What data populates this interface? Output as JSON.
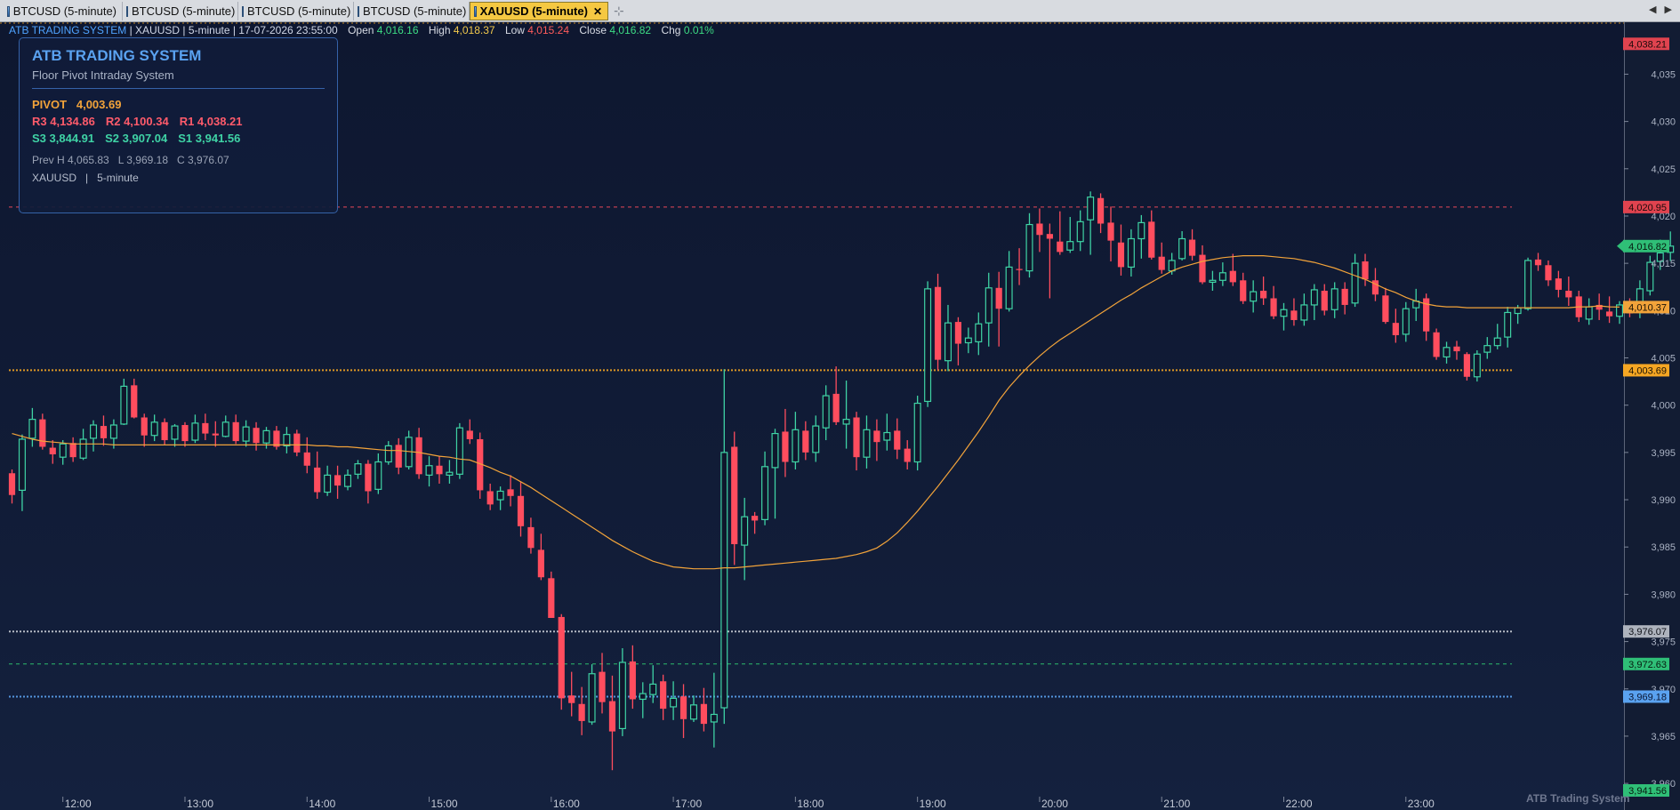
{
  "tabs": [
    {
      "label": "BTCUSD (5-minute)",
      "active": false
    },
    {
      "label": "BTCUSD (5-minute)",
      "active": false
    },
    {
      "label": "BTCUSD (5-minute)",
      "active": false
    },
    {
      "label": "BTCUSD (5-minute)",
      "active": false
    },
    {
      "label": "XAUUSD (5-minute)",
      "active": true
    }
  ],
  "tab_close": "✕",
  "new_tab_icon": "pin-icon",
  "header": {
    "system": "ATB TRADING SYSTEM",
    "rest": " | XAUUSD | 5-minute | 17-07-2026 23:55:00",
    "open_label": "Open",
    "open": "4,016.16",
    "high_label": "High",
    "high": "4,018.37",
    "low_label": "Low",
    "low": "4,015.24",
    "close_label": "Close",
    "close": "4,016.82",
    "chg_label": "Chg",
    "chg": "0.01%"
  },
  "panel": {
    "title": "ATB TRADING SYSTEM",
    "subtitle": "Floor Pivot Intraday System",
    "pivot_label": "PIVOT",
    "pivot": "4,003.69",
    "r3": "R3 4,134.86",
    "r2": "R2 4,100.34",
    "r1": "R1 4,038.21",
    "s3": "S3 3,844.91",
    "s2": "S2 3,907.04",
    "s1": "S1 3,941.56",
    "prev": "Prev H 4,065.83   L 3,969.18   C 3,976.07",
    "symbol": "XAUUSD   |   5-minute"
  },
  "watermark": "ATB Trading System",
  "colors": {
    "up": "#3fd3a5",
    "down": "#ff4d5e",
    "ma": "#f2a33a",
    "pivot": "#f5a623",
    "bg": "#0f172c",
    "r1": "#ff5b6b",
    "prevH": "#c7cbd3",
    "prevL": "#5aa2f0",
    "s1": "#2ecc71"
  },
  "chart_data": {
    "type": "candlestick",
    "symbol": "XAUUSD",
    "interval": "5-minute",
    "ylim": [
      3958.6,
      4040.4
    ],
    "yticks": [
      3960,
      3965,
      3970,
      3975,
      3980,
      3985,
      3990,
      3995,
      4000,
      4005,
      4010,
      4015,
      4020,
      4025,
      4030,
      4035
    ],
    "xtick_labels": [
      "12:00",
      "13:00",
      "14:00",
      "15:00",
      "16:00",
      "17:00",
      "18:00",
      "19:00",
      "20:00",
      "21:00",
      "22:00",
      "23:00"
    ],
    "bars_per_hour": 12,
    "first_bar_time": "11:35",
    "candles": [
      [
        3992.8,
        3993.2,
        3989.6,
        3990.5
      ],
      [
        3991.0,
        3996.9,
        3988.8,
        3996.4
      ],
      [
        3996.5,
        3999.7,
        3995.6,
        3998.5
      ],
      [
        3998.5,
        3999.1,
        3995.3,
        3995.6
      ],
      [
        3995.5,
        3996.3,
        3993.8,
        3994.8
      ],
      [
        3994.5,
        3996.3,
        3993.7,
        3995.9
      ],
      [
        3996.0,
        3996.6,
        3994.0,
        3994.5
      ],
      [
        3994.4,
        3997.5,
        3994.2,
        3996.4
      ],
      [
        3996.5,
        3998.4,
        3995.1,
        3997.9
      ],
      [
        3997.8,
        3998.9,
        3995.7,
        3996.5
      ],
      [
        3996.5,
        3998.5,
        3995.4,
        3997.9
      ],
      [
        3998.0,
        4002.8,
        3997.9,
        4002.0
      ],
      [
        4002.1,
        4002.8,
        3998.6,
        3998.7
      ],
      [
        3998.7,
        3999.1,
        3995.6,
        3996.8
      ],
      [
        3996.8,
        3999.0,
        3996.2,
        3998.2
      ],
      [
        3998.2,
        3998.6,
        3995.8,
        3996.3
      ],
      [
        3996.4,
        3998.0,
        3995.6,
        3997.8
      ],
      [
        3997.9,
        3998.2,
        3995.6,
        3996.2
      ],
      [
        3996.3,
        3999.0,
        3996.0,
        3998.1
      ],
      [
        3998.1,
        3999.1,
        3996.3,
        3997.0
      ],
      [
        3997.0,
        3998.3,
        3995.6,
        3996.8
      ],
      [
        3996.7,
        3998.9,
        3996.6,
        3998.2
      ],
      [
        3998.2,
        3999.0,
        3995.9,
        3996.2
      ],
      [
        3996.2,
        3998.4,
        3995.6,
        3997.7
      ],
      [
        3997.6,
        3998.2,
        3995.2,
        3996.0
      ],
      [
        3996.0,
        3997.7,
        3995.4,
        3997.3
      ],
      [
        3997.3,
        3997.8,
        3995.3,
        3995.6
      ],
      [
        3995.7,
        3997.7,
        3994.9,
        3996.9
      ],
      [
        3997.0,
        3997.4,
        3994.6,
        3995.0
      ],
      [
        3995.0,
        3996.6,
        3992.8,
        3993.6
      ],
      [
        3993.4,
        3995.1,
        3990.1,
        3990.8
      ],
      [
        3990.8,
        3993.6,
        3990.4,
        3992.6
      ],
      [
        3992.6,
        3993.6,
        3990.1,
        3991.5
      ],
      [
        3991.4,
        3993.2,
        3991.0,
        3992.6
      ],
      [
        3992.7,
        3994.2,
        3992.2,
        3993.8
      ],
      [
        3993.8,
        3994.2,
        3989.6,
        3990.9
      ],
      [
        3991.1,
        3994.9,
        3990.6,
        3994.0
      ],
      [
        3994.0,
        3996.2,
        3993.7,
        3995.7
      ],
      [
        3995.8,
        3996.5,
        3992.7,
        3993.4
      ],
      [
        3993.5,
        3997.3,
        3993.2,
        3996.6
      ],
      [
        3996.6,
        3997.6,
        3992.2,
        3992.7
      ],
      [
        3992.6,
        3994.6,
        3991.4,
        3993.6
      ],
      [
        3993.6,
        3994.6,
        3991.7,
        3992.7
      ],
      [
        3992.6,
        3994.2,
        3991.7,
        3992.9
      ],
      [
        3992.7,
        3998.1,
        3992.2,
        3997.6
      ],
      [
        3997.3,
        3998.5,
        3995.9,
        3996.4
      ],
      [
        3996.4,
        3997.1,
        3990.1,
        3991.0
      ],
      [
        3990.9,
        3991.7,
        3988.9,
        3989.5
      ],
      [
        3990.0,
        3991.4,
        3988.9,
        3990.9
      ],
      [
        3991.1,
        3992.6,
        3989.3,
        3990.4
      ],
      [
        3990.4,
        3991.9,
        3986.1,
        3987.2
      ],
      [
        3987.1,
        3988.1,
        3984.3,
        3984.9
      ],
      [
        3984.7,
        3986.4,
        3981.5,
        3981.8
      ],
      [
        3981.7,
        3982.4,
        3977.5,
        3977.5
      ],
      [
        3977.6,
        3977.9,
        3967.8,
        3969.0
      ],
      [
        3969.3,
        3971.8,
        3967.1,
        3968.5
      ],
      [
        3968.4,
        3970.2,
        3965.1,
        3966.6
      ],
      [
        3966.5,
        3972.6,
        3966.2,
        3971.6
      ],
      [
        3971.8,
        3973.8,
        3967.4,
        3968.6
      ],
      [
        3968.7,
        3971.4,
        3961.4,
        3965.5
      ],
      [
        3965.8,
        3974.3,
        3965.0,
        3972.8
      ],
      [
        3972.9,
        3974.6,
        3967.9,
        3968.9
      ],
      [
        3968.9,
        3970.7,
        3966.9,
        3969.5
      ],
      [
        3969.4,
        3972.5,
        3968.5,
        3970.5
      ],
      [
        3970.8,
        3971.5,
        3966.7,
        3967.9
      ],
      [
        3968.1,
        3970.8,
        3966.7,
        3969.0
      ],
      [
        3969.2,
        3970.5,
        3964.8,
        3966.8
      ],
      [
        3966.8,
        3969.3,
        3966.5,
        3968.3
      ],
      [
        3968.4,
        3970.1,
        3965.5,
        3966.3
      ],
      [
        3966.5,
        3971.7,
        3963.8,
        3967.3
      ],
      [
        3968.0,
        4003.8,
        3966.3,
        3995.0
      ],
      [
        3995.6,
        3997.2,
        3983.1,
        3985.3
      ],
      [
        3985.2,
        3990.2,
        3981.5,
        3988.2
      ],
      [
        3988.3,
        3988.7,
        3986.4,
        3987.8
      ],
      [
        3987.9,
        3995.1,
        3987.3,
        3993.5
      ],
      [
        3993.4,
        3997.5,
        3988.0,
        3997.0
      ],
      [
        3997.2,
        3999.6,
        3992.4,
        3994.0
      ],
      [
        3994.0,
        3999.3,
        3993.2,
        3997.4
      ],
      [
        3997.3,
        3998.3,
        3994.2,
        3995.0
      ],
      [
        3995.0,
        3998.9,
        3994.0,
        3997.8
      ],
      [
        3997.6,
        4002.1,
        3996.3,
        4001.0
      ],
      [
        4001.2,
        4004.1,
        3997.9,
        3998.2
      ],
      [
        3998.0,
        4002.6,
        3995.4,
        3998.5
      ],
      [
        3998.7,
        3999.3,
        3993.1,
        3994.5
      ],
      [
        3994.5,
        3998.9,
        3993.3,
        3997.4
      ],
      [
        3997.3,
        3998.5,
        3994.1,
        3996.1
      ],
      [
        3996.3,
        3999.1,
        3995.2,
        3997.1
      ],
      [
        3997.3,
        3998.6,
        3994.3,
        3995.3
      ],
      [
        3995.4,
        3996.3,
        3993.2,
        3994.0
      ],
      [
        3994.0,
        4001.0,
        3993.1,
        4000.2
      ],
      [
        4000.4,
        4013.1,
        3999.8,
        4012.3
      ],
      [
        4012.5,
        4013.9,
        4003.7,
        4004.8
      ],
      [
        4004.7,
        4010.6,
        4003.6,
        4008.7
      ],
      [
        4008.8,
        4009.3,
        4004.2,
        4006.5
      ],
      [
        4006.6,
        4008.2,
        4005.5,
        4007.1
      ],
      [
        4006.7,
        4009.8,
        4005.3,
        4008.6
      ],
      [
        4008.7,
        4014.0,
        4006.2,
        4012.4
      ],
      [
        4012.4,
        4014.1,
        4006.2,
        4010.2
      ],
      [
        4010.2,
        4016.3,
        4009.9,
        4014.6
      ],
      [
        4014.4,
        4016.6,
        4012.7,
        4014.3
      ],
      [
        4014.2,
        4020.3,
        4013.5,
        4019.1
      ],
      [
        4019.2,
        4020.8,
        4016.2,
        4018.0
      ],
      [
        4018.1,
        4019.2,
        4011.3,
        4017.6
      ],
      [
        4017.3,
        4020.5,
        4015.9,
        4016.2
      ],
      [
        4016.4,
        4019.9,
        4016.1,
        4017.3
      ],
      [
        4017.3,
        4020.6,
        4016.3,
        4019.4
      ],
      [
        4019.6,
        4022.6,
        4015.9,
        4022.0
      ],
      [
        4021.9,
        4022.4,
        4018.2,
        4019.2
      ],
      [
        4019.3,
        4021.0,
        4015.2,
        4017.4
      ],
      [
        4017.2,
        4019.1,
        4013.7,
        4014.6
      ],
      [
        4014.6,
        4018.6,
        4013.6,
        4017.6
      ],
      [
        4017.6,
        4020.1,
        4015.5,
        4019.3
      ],
      [
        4019.4,
        4020.6,
        4015.4,
        4015.6
      ],
      [
        4015.7,
        4017.2,
        4013.9,
        4014.3
      ],
      [
        4014.2,
        4016.1,
        4013.8,
        4015.3
      ],
      [
        4015.5,
        4018.4,
        4015.3,
        4017.6
      ],
      [
        4017.5,
        4018.6,
        4015.3,
        4015.8
      ],
      [
        4015.9,
        4016.9,
        4012.8,
        4013.0
      ],
      [
        4013.0,
        4014.2,
        4012.1,
        4013.2
      ],
      [
        4013.2,
        4015.1,
        4012.6,
        4014.0
      ],
      [
        4014.2,
        4016.0,
        4012.6,
        4013.0
      ],
      [
        4013.2,
        4014.0,
        4010.7,
        4011.0
      ],
      [
        4011.0,
        4013.2,
        4009.8,
        4012.0
      ],
      [
        4012.1,
        4013.6,
        4010.6,
        4011.3
      ],
      [
        4011.3,
        4012.6,
        4009.1,
        4009.4
      ],
      [
        4009.4,
        4010.8,
        4007.9,
        4010.1
      ],
      [
        4010.0,
        4011.3,
        4008.4,
        4009.0
      ],
      [
        4009.0,
        4011.8,
        4008.4,
        4010.6
      ],
      [
        4010.6,
        4012.8,
        4009.0,
        4012.2
      ],
      [
        4012.1,
        4012.8,
        4009.5,
        4010.0
      ],
      [
        4010.1,
        4013.0,
        4009.2,
        4012.3
      ],
      [
        4012.3,
        4013.0,
        4009.6,
        4010.6
      ],
      [
        4010.8,
        4016.0,
        4010.4,
        4015.0
      ],
      [
        4015.2,
        4016.0,
        4012.6,
        4013.3
      ],
      [
        4013.2,
        4014.5,
        4011.0,
        4011.7
      ],
      [
        4011.6,
        4012.4,
        4008.6,
        4008.8
      ],
      [
        4008.7,
        4010.2,
        4006.6,
        4007.4
      ],
      [
        4007.5,
        4010.9,
        4006.7,
        4010.2
      ],
      [
        4010.3,
        4012.3,
        4008.9,
        4011.0
      ],
      [
        4011.3,
        4011.8,
        4006.8,
        4007.8
      ],
      [
        4007.7,
        4008.1,
        4004.8,
        4005.1
      ],
      [
        4005.1,
        4006.7,
        4004.4,
        4006.1
      ],
      [
        4006.2,
        4006.8,
        4004.8,
        4005.7
      ],
      [
        4005.4,
        4005.6,
        4002.6,
        4003.0
      ],
      [
        4003.0,
        4005.8,
        4002.5,
        4005.4
      ],
      [
        4005.6,
        4007.2,
        4004.9,
        4006.3
      ],
      [
        4006.3,
        4008.6,
        4005.9,
        4007.1
      ],
      [
        4007.2,
        4010.4,
        4006.1,
        4009.8
      ],
      [
        4009.7,
        4010.6,
        4008.6,
        4010.3
      ],
      [
        4010.2,
        4015.6,
        4010.0,
        4015.3
      ],
      [
        4015.4,
        4016.1,
        4014.2,
        4014.8
      ],
      [
        4014.8,
        4015.3,
        4012.6,
        4013.2
      ],
      [
        4013.4,
        4014.2,
        4011.4,
        4012.2
      ],
      [
        4012.1,
        4013.6,
        4010.5,
        4011.4
      ],
      [
        4011.5,
        4012.1,
        4008.8,
        4009.3
      ],
      [
        4009.1,
        4011.3,
        4008.5,
        4010.4
      ],
      [
        4010.6,
        4011.8,
        4009.0,
        4010.1
      ],
      [
        4009.9,
        4011.5,
        4008.7,
        4009.4
      ],
      [
        4009.4,
        4011.0,
        4008.6,
        4010.6
      ],
      [
        4010.5,
        4011.3,
        4009.3,
        4009.7
      ],
      [
        4009.9,
        4013.2,
        4009.2,
        4012.3
      ],
      [
        4012.1,
        4015.8,
        4011.6,
        4015.1
      ],
      [
        4015.2,
        4017.5,
        4014.3,
        4016.1
      ],
      [
        4016.16,
        4018.37,
        4015.24,
        4016.82
      ]
    ],
    "ma": [
      3997.0,
      3996.7,
      3996.4,
      3996.2,
      3996.1,
      3996.0,
      3995.9,
      3995.9,
      3995.9,
      3995.9,
      3995.8,
      3995.8,
      3995.8,
      3995.8,
      3995.8,
      3995.8,
      3995.8,
      3995.8,
      3995.8,
      3995.8,
      3995.8,
      3995.8,
      3995.8,
      3995.8,
      3995.8,
      3995.8,
      3995.8,
      3995.8,
      3995.8,
      3995.8,
      3995.7,
      3995.7,
      3995.6,
      3995.6,
      3995.5,
      3995.4,
      3995.3,
      3995.2,
      3995.2,
      3995.1,
      3995.0,
      3994.8,
      3994.6,
      3994.5,
      3994.3,
      3994.2,
      3993.8,
      3993.4,
      3992.9,
      3992.5,
      3991.9,
      3991.3,
      3990.6,
      3989.9,
      3989.2,
      3988.5,
      3987.8,
      3987.1,
      3986.4,
      3985.7,
      3985.1,
      3984.5,
      3984.0,
      3983.5,
      3983.2,
      3982.9,
      3982.8,
      3982.7,
      3982.7,
      3982.7,
      3982.8,
      3982.8,
      3982.9,
      3983.0,
      3983.1,
      3983.2,
      3983.3,
      3983.4,
      3983.5,
      3983.6,
      3983.7,
      3983.8,
      3984.0,
      3984.2,
      3984.5,
      3984.9,
      3985.6,
      3986.5,
      3987.6,
      3988.8,
      3990.1,
      3991.4,
      3992.8,
      3994.2,
      3995.7,
      3997.2,
      3998.8,
      4000.5,
      4001.9,
      4003.1,
      4004.2,
      4005.2,
      4006.1,
      4006.9,
      4007.6,
      4008.3,
      4009.0,
      4009.7,
      4010.4,
      4011.1,
      4011.7,
      4012.4,
      4013.0,
      4013.6,
      4014.2,
      4014.6,
      4014.9,
      4015.2,
      4015.4,
      4015.6,
      4015.7,
      4015.8,
      4015.8,
      4015.8,
      4015.7,
      4015.6,
      4015.5,
      4015.3,
      4015.1,
      4014.8,
      4014.5,
      4014.1,
      4013.7,
      4013.3,
      4012.8,
      4012.3,
      4011.9,
      4011.4,
      4011.0,
      4010.7,
      4010.5,
      4010.4,
      4010.4,
      4010.3,
      4010.3,
      4010.3,
      4010.3,
      4010.3,
      4010.3,
      4010.3,
      4010.3,
      4010.3,
      4010.3,
      4010.3,
      4010.4,
      4010.4,
      4010.5,
      4010.4,
      4010.37
    ],
    "lines": [
      {
        "name": "R1",
        "value": 4038.21,
        "label": "4,038.21",
        "color": "#ff4d5e",
        "style": "dotted"
      },
      {
        "name": "prev-high",
        "value": 4020.95,
        "label": "4,020.95",
        "color": "#ff4d5e",
        "style": "dashed"
      },
      {
        "name": "PIVOT",
        "value": 4003.69,
        "label": "4,003.69",
        "color": "#f5a623",
        "style": "dotted"
      },
      {
        "name": "prev-close",
        "value": 3976.07,
        "label": "3,976.07",
        "color": "#c7cbd3",
        "style": "dotted"
      },
      {
        "name": "prev-mid",
        "value": 3972.63,
        "label": "3,972.63",
        "color": "#2ecc71",
        "style": "dashed"
      },
      {
        "name": "prev-low",
        "value": 3969.18,
        "label": "3,969.18",
        "color": "#5aa2f0",
        "style": "dotted"
      }
    ],
    "axis_tags": [
      {
        "value": 4038.21,
        "label": "4,038.21",
        "bg": "#e0434f",
        "fg": "#1a0a0a"
      },
      {
        "value": 4020.95,
        "label": "4,020.95",
        "bg": "#e0434f",
        "fg": "#1a0a0a"
      },
      {
        "value": 4016.82,
        "label": "4,016.82",
        "bg": "#2fbf77",
        "fg": "#071a10",
        "arrow": true
      },
      {
        "value": 4010.37,
        "label": "4,010.37",
        "bg": "#f2a33a",
        "fg": "#1a1205"
      },
      {
        "value": 4003.69,
        "label": "4,003.69",
        "bg": "#f5a623",
        "fg": "#1a1205"
      },
      {
        "value": 3976.07,
        "label": "3,976.07",
        "bg": "#aeb3bd",
        "fg": "#10131a"
      },
      {
        "value": 3972.63,
        "label": "3,972.63",
        "bg": "#2fbf77",
        "fg": "#071a10"
      },
      {
        "value": 3969.18,
        "label": "3,969.18",
        "bg": "#5aa2f0",
        "fg": "#0a1530"
      },
      {
        "value": 3958.6,
        "label": "3,941.56",
        "bg": "#2fbf77",
        "fg": "#071a10"
      }
    ]
  }
}
